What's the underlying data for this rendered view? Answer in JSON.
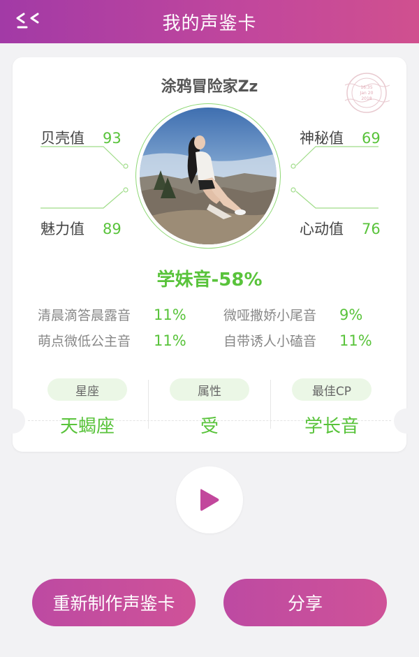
{
  "header": {
    "title": "我的声鉴卡",
    "back_icon": "back-arrow-icon"
  },
  "card": {
    "username": "涂鸦冒险家Zz",
    "stamp": {
      "line1": "16:35",
      "line2": "Jan 20",
      "line3": "2018"
    },
    "stats": [
      {
        "label": "贝壳值",
        "value": "93"
      },
      {
        "label": "神秘值",
        "value": "69"
      },
      {
        "label": "魅力值",
        "value": "89"
      },
      {
        "label": "心动值",
        "value": "76"
      }
    ],
    "main_voice": "学妹音-58%",
    "sub_voices": [
      {
        "name": "清晨滴答晨露音",
        "pct": "11%"
      },
      {
        "name": "微哑撒娇小尾音",
        "pct": "9%"
      },
      {
        "name": "萌点微低公主音",
        "pct": "11%"
      },
      {
        "name": "自带诱人小磕音",
        "pct": "11%"
      }
    ],
    "info": [
      {
        "label": "星座",
        "value": "天蝎座"
      },
      {
        "label": "属性",
        "value": "受"
      },
      {
        "label": "最佳CP",
        "value": "学长音"
      }
    ]
  },
  "controls": {
    "play_icon": "play-icon"
  },
  "buttons": {
    "remake": "重新制作声鉴卡",
    "share": "分享"
  },
  "colors": {
    "accent": "#59c33b",
    "brand": "#c2479c",
    "background": "#f2f2f4"
  }
}
